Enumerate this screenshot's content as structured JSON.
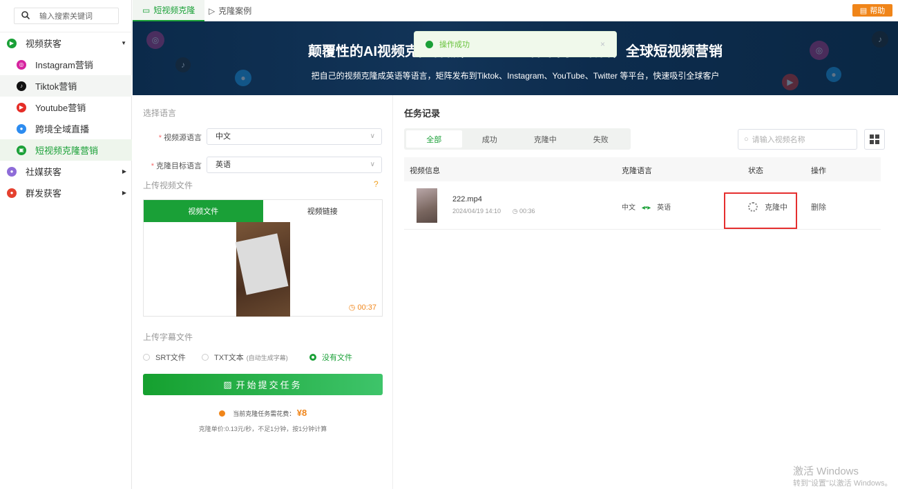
{
  "sidebar": {
    "search_placeholder": "输入搜索关键词",
    "groups": [
      {
        "label": "视频获客",
        "color": "#1aa037"
      },
      {
        "label": "社媒获客",
        "color": "#8e6cd8"
      },
      {
        "label": "群发获客",
        "color": "#e5412f"
      }
    ],
    "items": [
      {
        "label": "Instagram营销",
        "color": "#d6249f"
      },
      {
        "label": "Tiktok营销",
        "color": "#111111"
      },
      {
        "label": "Youtube营销",
        "color": "#e52d27"
      },
      {
        "label": "跨境全域直播",
        "color": "#2d8cf0"
      },
      {
        "label": "短视频克隆营销",
        "color": "#1aa037"
      }
    ]
  },
  "topbar": {
    "tabs": [
      "短视频克隆",
      "克隆案例"
    ],
    "help_label": "帮助"
  },
  "banner": {
    "title": "颠覆性的AI视频克隆神器，口型……种不同的语言，全球短视频营销",
    "subtitle": "把自己的视频克隆成英语等语言，矩阵发布到Tiktok、Instagram、YouTube、Twitter 等平台，快速吸引全球客户"
  },
  "toast": {
    "message": "操作成功",
    "close": "×"
  },
  "form": {
    "select_language_label": "选择语言",
    "source_label": "视频源语言",
    "source_value": "中文",
    "target_label": "克隆目标语言",
    "target_value": "英语",
    "upload_video_label": "上传视频文件",
    "upload_tabs": [
      "视频文件",
      "视频链接"
    ],
    "video_duration": "00:37",
    "upload_subtitle_label": "上传字幕文件",
    "subtitle_options": [
      {
        "label": "SRT文件",
        "note": ""
      },
      {
        "label": "TXT文本",
        "note": "(自动生成字幕)"
      },
      {
        "label": "没有文件",
        "note": ""
      }
    ],
    "submit_label": "开始提交任务",
    "cost_label": "当前克隆任务需花费：",
    "cost_amount": "¥8",
    "price_note": "克隆单价:0.13元/秒，不足1分钟，按1分钟计算"
  },
  "tasks": {
    "title": "任务记录",
    "filters": [
      "全部",
      "成功",
      "克隆中",
      "失败"
    ],
    "search_placeholder": "请输入视频名称",
    "columns": [
      "视频信息",
      "克隆语言",
      "状态",
      "操作"
    ],
    "rows": [
      {
        "name": "222.mp4",
        "date": "2024/04/19 14:10",
        "duration": "00:36",
        "source_lang": "中文",
        "target_lang": "英语",
        "status": "克隆中",
        "action": "删除"
      }
    ]
  },
  "watermark": {
    "line1": "激活 Windows",
    "line2": "转到\"设置\"以激活 Windows。"
  }
}
